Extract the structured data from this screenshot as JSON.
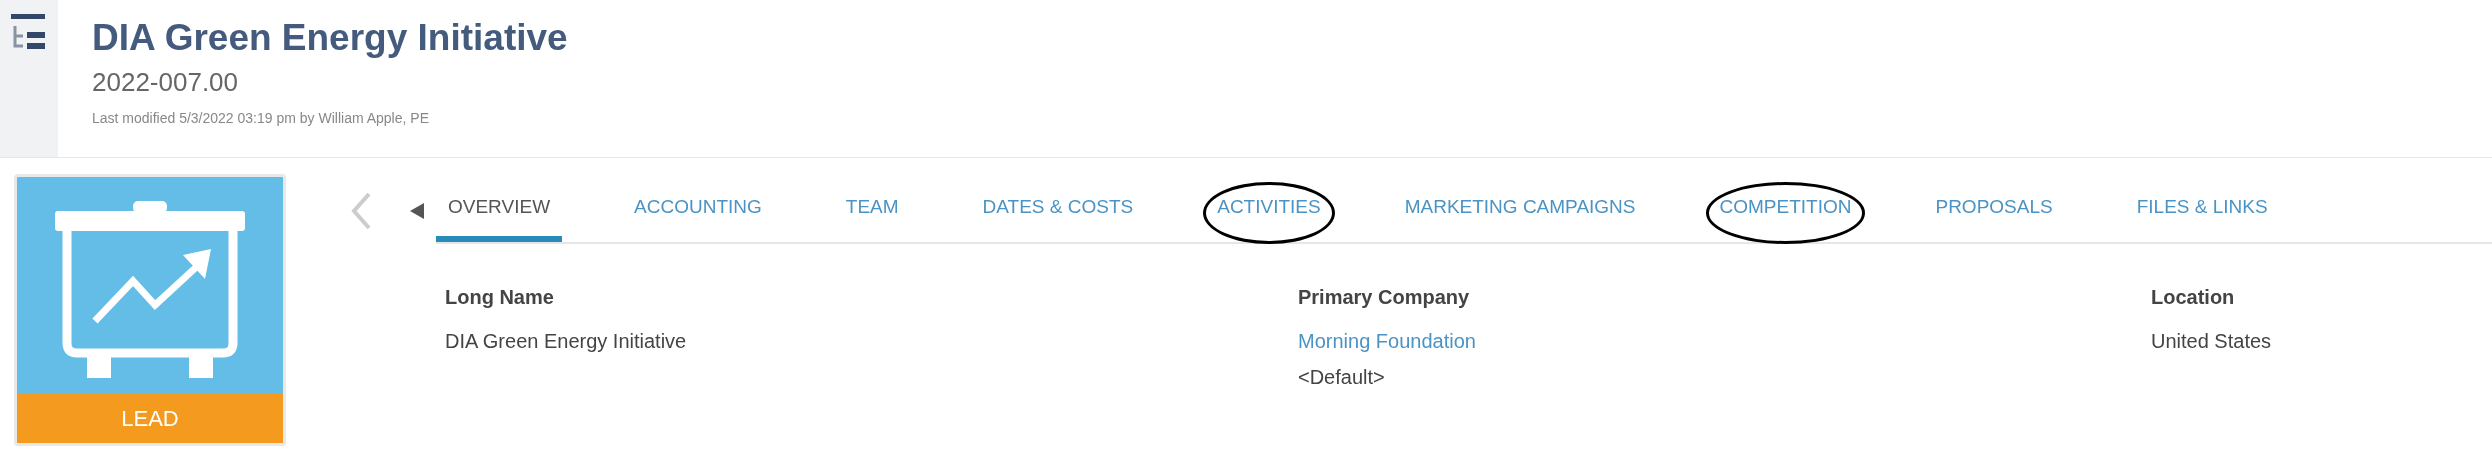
{
  "header": {
    "title": "DIA Green Energy Initiative",
    "number": "2022-007.00",
    "last_modified": "Last modified 5/3/2022 03:19 pm by William Apple, PE"
  },
  "status_card": {
    "label": "LEAD"
  },
  "tabs": [
    {
      "label": "OVERVIEW",
      "selected": true,
      "circled": false
    },
    {
      "label": "ACCOUNTING",
      "selected": false,
      "circled": false
    },
    {
      "label": "TEAM",
      "selected": false,
      "circled": false
    },
    {
      "label": "DATES & COSTS",
      "selected": false,
      "circled": false
    },
    {
      "label": "ACTIVITIES",
      "selected": false,
      "circled": true
    },
    {
      "label": "MARKETING CAMPAIGNS",
      "selected": false,
      "circled": false
    },
    {
      "label": "COMPETITION",
      "selected": false,
      "circled": true
    },
    {
      "label": "PROPOSALS",
      "selected": false,
      "circled": false
    },
    {
      "label": "FILES & LINKS",
      "selected": false,
      "circled": false
    }
  ],
  "fields": [
    {
      "label": "Long Name",
      "values": [
        {
          "text": "DIA Green Energy Initiative",
          "kind": "text"
        }
      ]
    },
    {
      "label": "Primary Company",
      "values": [
        {
          "text": "Morning Foundation",
          "kind": "link"
        },
        {
          "text": "<Default>",
          "kind": "text"
        }
      ]
    },
    {
      "label": "Location",
      "values": [
        {
          "text": "United States",
          "kind": "text"
        }
      ]
    }
  ]
}
